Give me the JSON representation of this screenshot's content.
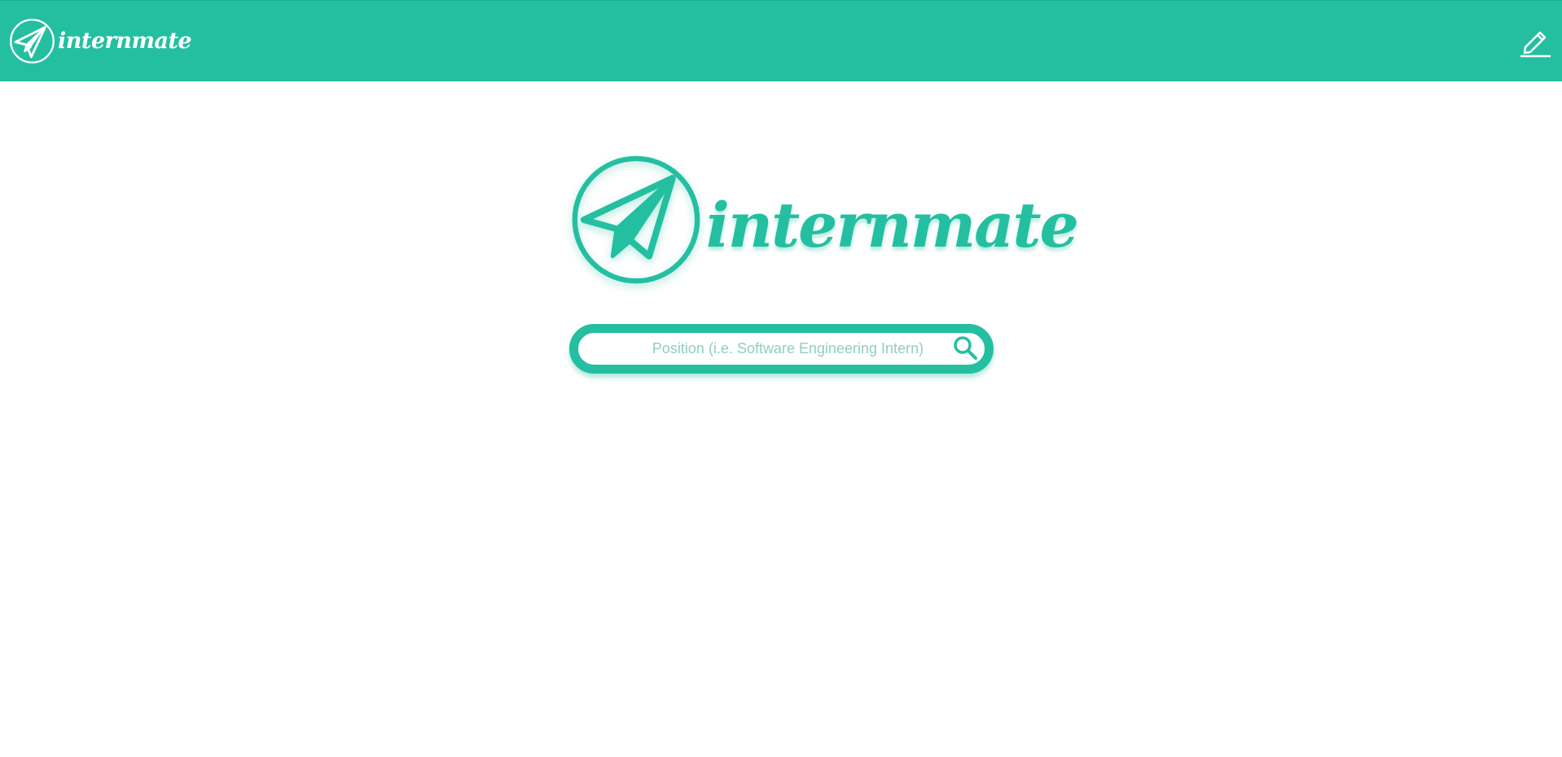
{
  "header": {
    "brand_name": "internmate",
    "logo_icon": "paper-plane-icon",
    "edit_icon": "pencil-icon"
  },
  "hero": {
    "brand_name": "internmate",
    "logo_icon": "paper-plane-icon"
  },
  "search": {
    "placeholder": "Position (i.e. Software Engineering Intern)",
    "value": "",
    "icon": "search-icon"
  },
  "colors": {
    "brand": "#24bfa1",
    "placeholder": "#8fcfc2",
    "background": "#ffffff"
  }
}
